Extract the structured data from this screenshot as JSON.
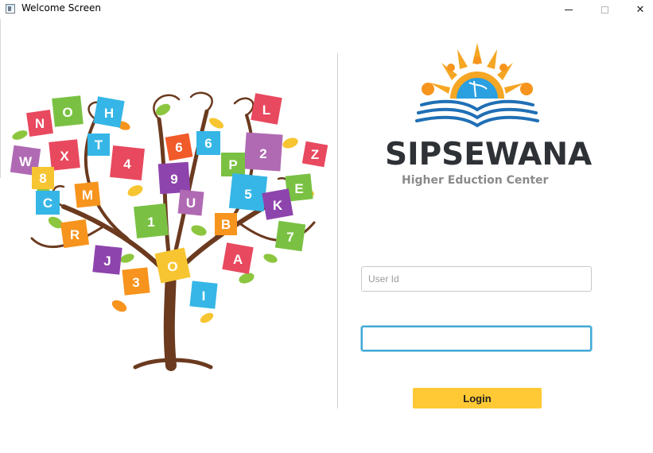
{
  "window": {
    "title": "Welcome Screen",
    "controls": {
      "minimize": "minimize-icon",
      "maximize": "maximize-icon",
      "close": "close-icon",
      "close_glyph": "✕"
    }
  },
  "brand": {
    "name": "SIPSEWANA",
    "tagline": "Higher Eduction Center",
    "colors": {
      "sun": "#f5a623",
      "globe": "#2aa0e0",
      "book": "#1f6fb5",
      "text": "#2e3135"
    }
  },
  "illustration": {
    "letters": [
      "N",
      "O",
      "H",
      "L",
      "6",
      "X",
      "T",
      "4",
      "6",
      "2",
      "W",
      "8",
      "M",
      "9",
      "P",
      "5",
      "E",
      "C",
      "U",
      "K",
      "B",
      "R",
      "1",
      "J",
      "O",
      "A",
      "3",
      "I",
      "Z",
      "7"
    ]
  },
  "form": {
    "user_id": {
      "placeholder": "User Id",
      "value": ""
    },
    "password": {
      "placeholder": "",
      "value": ""
    },
    "login_label": "Login"
  },
  "colors": {
    "accent_button": "#ffc936",
    "focus_ring": "#3fa9d6"
  }
}
